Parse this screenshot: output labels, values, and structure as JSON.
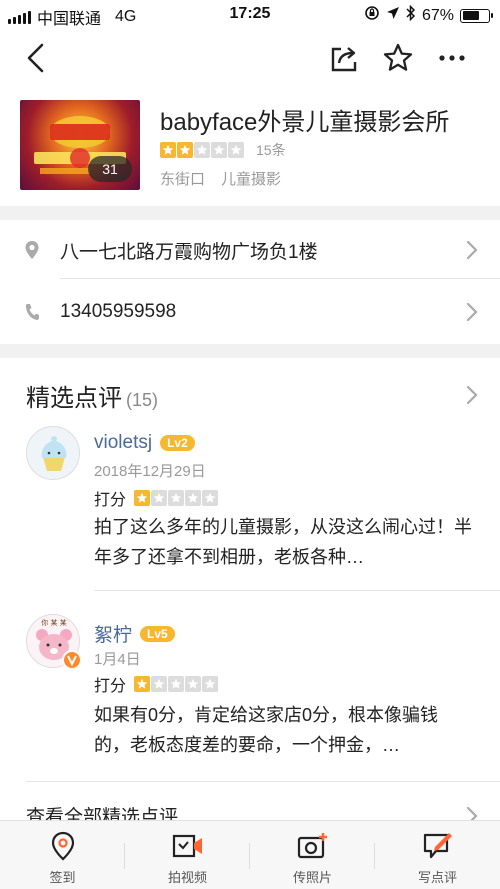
{
  "status_bar": {
    "carrier": "中国联通",
    "network": "4G",
    "time": "17:25",
    "battery": "67%",
    "battery_level": 0.67
  },
  "nav": {
    "back_icon": "chevron-left-icon",
    "share_icon": "share-icon",
    "favorite_icon": "star-outline-icon",
    "more_icon": "more-dots-icon"
  },
  "shop": {
    "name": "babyface外景儿童摄影会所",
    "rating_stars": 2,
    "review_count_label": "15条",
    "district": "东街口",
    "category": "儿童摄影",
    "photo_count": "31"
  },
  "address": {
    "text": "八一七北路万霞购物广场负1楼"
  },
  "phone": {
    "text": "13405959598"
  },
  "reviews_section": {
    "title": "精选点评",
    "count": "(15)",
    "see_all": "查看全部精选点评"
  },
  "reviews": [
    {
      "author": "violetsj",
      "level": "Lv2",
      "date": "2018年12月29日",
      "score_label": "打分",
      "stars": 1,
      "text": "拍了这么多年的儿童摄影，从没这么闹心过！半年多了还拿不到相册，老板各种…"
    },
    {
      "author": "絮柠",
      "level": "Lv5",
      "date": "1月4日",
      "score_label": "打分",
      "stars": 1,
      "text": "如果有0分，肯定给这家店0分，根本像骗钱的，老板态度差的要命，一个押金，…"
    }
  ],
  "tabs": [
    {
      "label": "签到",
      "icon": "location-checkin-icon"
    },
    {
      "label": "拍视频",
      "icon": "video-camera-icon"
    },
    {
      "label": "传照片",
      "icon": "upload-photo-icon"
    },
    {
      "label": "写点评",
      "icon": "write-review-icon"
    }
  ],
  "colors": {
    "star_filled": "#f5b82e",
    "star_empty": "#dcdcdc",
    "author_link": "#4a6a9c",
    "accent_orange": "#ff6633"
  }
}
